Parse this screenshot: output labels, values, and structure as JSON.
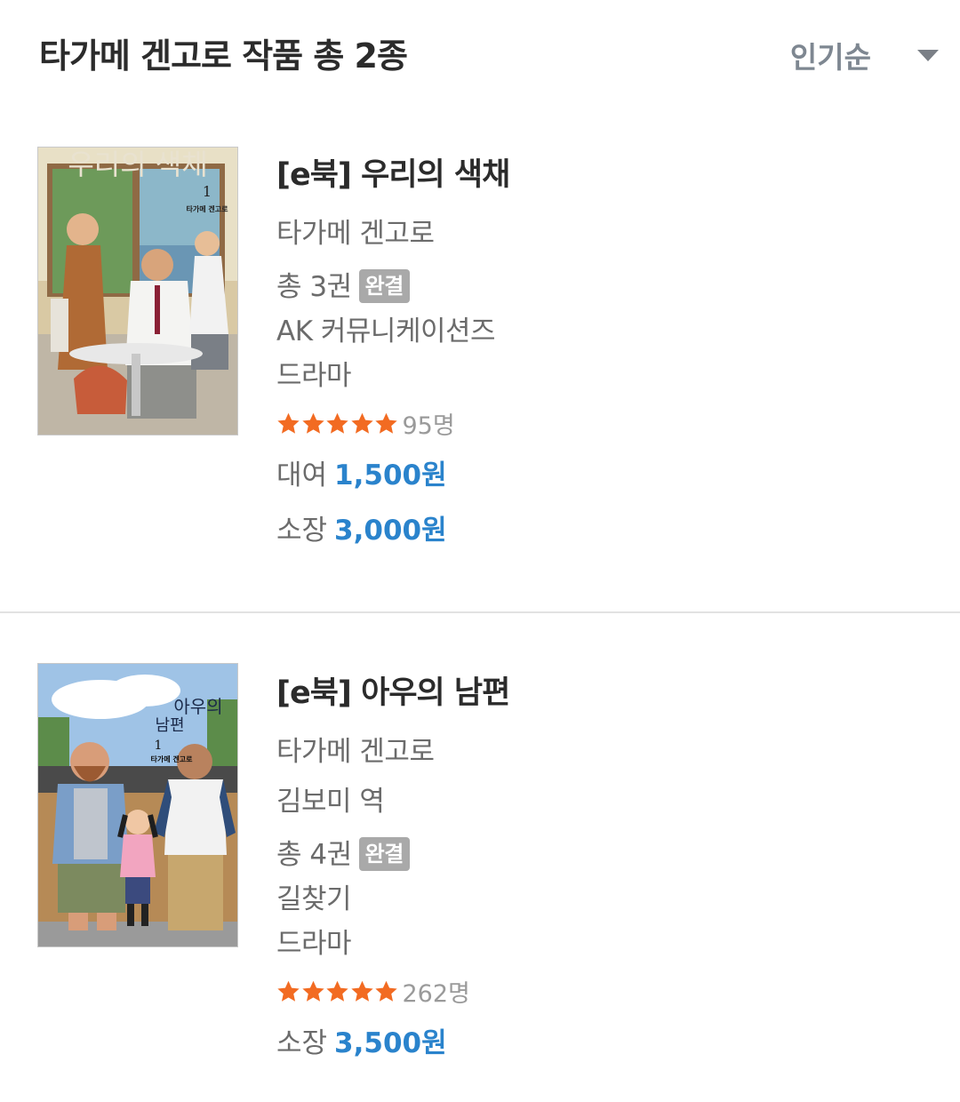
{
  "header": {
    "title": "타가메 겐고로 작품 총 2종",
    "sort_label": "인기순"
  },
  "books": [
    {
      "title": "[e북] 우리의 색채",
      "author": "타가메 겐고로",
      "volumes": "총 3권",
      "status_badge": "완결",
      "publisher": "AK 커뮤니케이션즈",
      "genre": "드라마",
      "rating_count": "95명",
      "rating_stars": 5,
      "rent_label": "대여",
      "rent_price": "1,500원",
      "own_label": "소장",
      "own_price": "3,000원",
      "cover_text": {
        "title": "우리의 색채",
        "volume": "1",
        "author": "타가메 겐고로"
      }
    },
    {
      "title": "[e북] 아우의 남편",
      "author": "타가메 겐고로",
      "translator": "김보미 역",
      "volumes": "총 4권",
      "status_badge": "완결",
      "publisher": "길찾기",
      "genre": "드라마",
      "rating_count": "262명",
      "rating_stars": 5,
      "own_label": "소장",
      "own_price": "3,500원",
      "cover_text": {
        "title_a": "아우의",
        "title_b": "남편",
        "volume": "1",
        "author": "타가메 겐고로"
      }
    }
  ],
  "colors": {
    "price_blue": "#2a83cc",
    "star_orange": "#f26b22",
    "badge_gray": "#a9a9a9"
  }
}
